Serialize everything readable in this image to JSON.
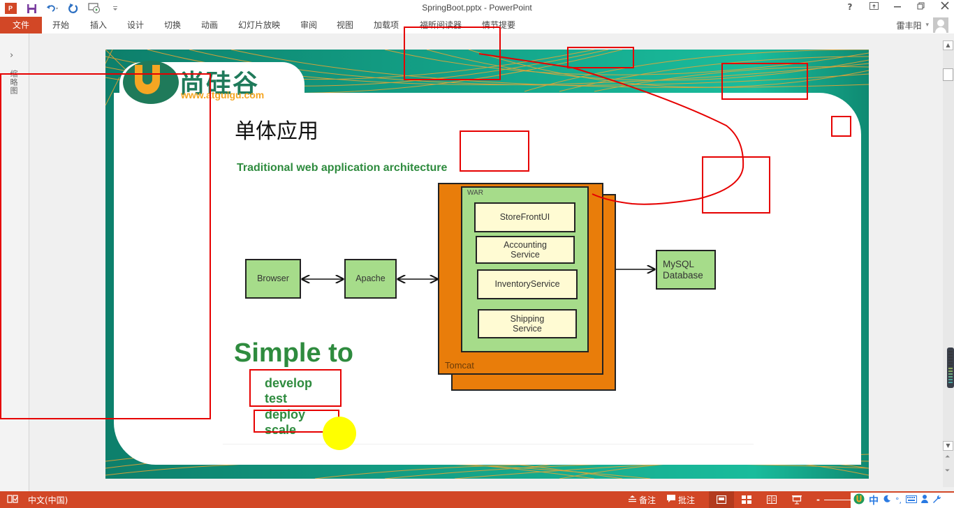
{
  "window": {
    "title": "SpringBoot.pptx - PowerPoint",
    "controls": [
      "help-icon",
      "ribbon-display-icon",
      "minimize-icon",
      "restore-icon",
      "close-icon"
    ],
    "help_label": "?"
  },
  "qat": {
    "icons": [
      "powerpoint-logo-icon",
      "save-icon",
      "undo-icon",
      "redo-icon",
      "presentation-icon",
      "customize-icon"
    ],
    "logo_text": "P"
  },
  "ribbon": {
    "tabs": [
      {
        "label": "文件",
        "active": true
      },
      {
        "label": "开始"
      },
      {
        "label": "插入"
      },
      {
        "label": "设计"
      },
      {
        "label": "切换"
      },
      {
        "label": "动画"
      },
      {
        "label": "幻灯片放映"
      },
      {
        "label": "审阅"
      },
      {
        "label": "视图"
      },
      {
        "label": "加载项"
      },
      {
        "label": "福昕阅读器"
      },
      {
        "label": "情节提要"
      }
    ],
    "user_name": "雷丰阳",
    "user_dropdown": "▾"
  },
  "thumbnail_pane": {
    "expand_icon": "›",
    "label": "缩略图"
  },
  "slide": {
    "logo_cn": "尚硅谷",
    "logo_url": "www.atguigu.com",
    "title": "单体应用",
    "subtitle": "Traditional web application architecture",
    "diagram": {
      "browser": "Browser",
      "apache": "Apache",
      "war_label": "WAR",
      "tomcat_label": "Tomcat",
      "services": [
        {
          "line1": "StoreFrontUI",
          "line2": ""
        },
        {
          "line1": "Accounting",
          "line2": "Service"
        },
        {
          "line1": "InventoryService",
          "line2": ""
        },
        {
          "line1": "Shipping",
          "line2": "Service"
        }
      ],
      "database_line1": "MySQL",
      "database_line2": "Database"
    },
    "simple_heading": "Simple to",
    "bullets": [
      "develop",
      "test",
      "deploy",
      "scale"
    ]
  },
  "statusbar": {
    "language": "中文(中国)",
    "notes": "备注",
    "comments": "批注",
    "views": [
      "normal-view-icon",
      "slide-sorter-icon",
      "reading-view-icon",
      "slideshow-icon"
    ]
  },
  "ime": {
    "mode": "中"
  },
  "colors": {
    "accent": "#d24726",
    "slide_teal": "#0f8a72",
    "diagram_green": "#a6dc8a",
    "diagram_cream": "#fffbd3",
    "diagram_orange": "#e97d0a",
    "text_green": "#2e8b3e",
    "annotation_red": "#e60000",
    "cursor_highlight": "#ffff00"
  }
}
